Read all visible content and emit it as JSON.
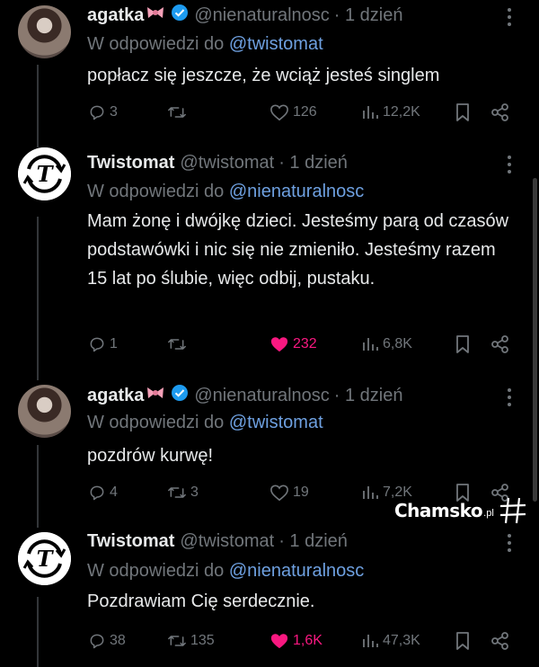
{
  "tweets": [
    {
      "name": "agatka",
      "handle": "@nienaturalnosc",
      "time": "· 1 dzień",
      "reply_prefix": "W odpowiedzi do",
      "reply_to": "@twistomat",
      "text": "popłacz się jeszcze, że wciąż jesteś singlem",
      "replies": "3",
      "retweets": "",
      "likes": "126",
      "views": "12,2K",
      "avatar": "photo",
      "verified": true,
      "bow": true,
      "liked": false
    },
    {
      "name": "Twistomat",
      "handle": "@twistomat",
      "time": "· 1 dzień",
      "reply_prefix": "W odpowiedzi do",
      "reply_to": "@nienaturalnosc",
      "text": "Mam żonę i dwójkę dzieci. Jesteśmy parą od czasów podstawówki i nic się nie zmieniło. Jesteśmy razem 15 lat po ślubie, więc odbij, pustaku.",
      "replies": "1",
      "retweets": "",
      "likes": "232",
      "views": "6,8K",
      "avatar": "logo",
      "verified": false,
      "bow": false,
      "liked": true
    },
    {
      "name": "agatka",
      "handle": "@nienaturalnosc",
      "time": "· 1 dzień",
      "reply_prefix": "W odpowiedzi do",
      "reply_to": "@twistomat",
      "text": "pozdrów kurwę!",
      "replies": "4",
      "retweets": "3",
      "likes": "19",
      "views": "7,2K",
      "avatar": "photo",
      "verified": true,
      "bow": true,
      "liked": false
    },
    {
      "name": "Twistomat",
      "handle": "@twistomat",
      "time": "· 1 dzień",
      "reply_prefix": "W odpowiedzi do",
      "reply_to": "@nienaturalnosc",
      "text": "Pozdrawiam Cię serdecznie.",
      "replies": "38",
      "retweets": "135",
      "likes": "1,6K",
      "views": "47,3K",
      "avatar": "logo",
      "verified": false,
      "bow": false,
      "liked": true
    }
  ],
  "watermark": {
    "text": "Chamsko",
    "suffix": ".pl"
  },
  "colors": {
    "background": "#000000",
    "text": "#e7e9ea",
    "muted": "#71767b",
    "link": "#6ea0e0",
    "like": "#f91880",
    "verified": "#1d9bf0"
  },
  "icons": [
    "reply-icon",
    "retweet-icon",
    "like-icon",
    "views-icon",
    "bookmark-icon",
    "share-icon",
    "more-icon",
    "verified-badge-icon",
    "bow-emoji-icon"
  ]
}
